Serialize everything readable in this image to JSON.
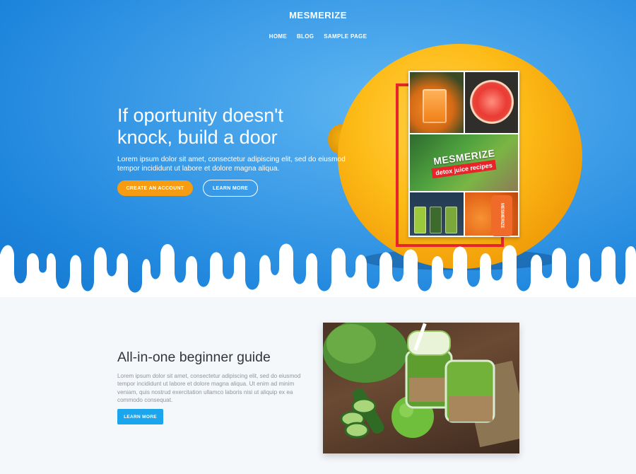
{
  "header": {
    "logo": "MESMERIZE",
    "nav": [
      "HOME",
      "BLOG",
      "SAMPLE PAGE"
    ]
  },
  "hero": {
    "title": "If oportunity doesn't knock, build a door",
    "text": "Lorem ipsum dolor sit amet, consectetur adipiscing elit, sed do eiusmod tempor incididunt ut labore et dolore magna aliqua.",
    "primary_button": "CREATE AN ACCOUNT",
    "secondary_button": "LEARN MORE",
    "book": {
      "brand": "MESMERIZE",
      "subtitle": "detox juice recipes",
      "bottle_label": "MESMERIZE"
    }
  },
  "guide": {
    "title": "All-in-one beginner guide",
    "text": "Lorem ipsum dolor sit amet, consectetur adipiscing elit, sed do eiusmod tempor incididunt ut labore et dolore magna aliqua. Ut enim ad minim veniam, quis nostrud exercitation ullamco laboris nisi ut aliquip ex ea commodo consequat.",
    "button": "LEARN MORE"
  },
  "colors": {
    "hero_blue": "#2a8fe3",
    "accent_orange": "#f59c13",
    "button_blue": "#1ba5ec",
    "book_red": "#e6242a",
    "page_bg": "#f4f8fb"
  }
}
